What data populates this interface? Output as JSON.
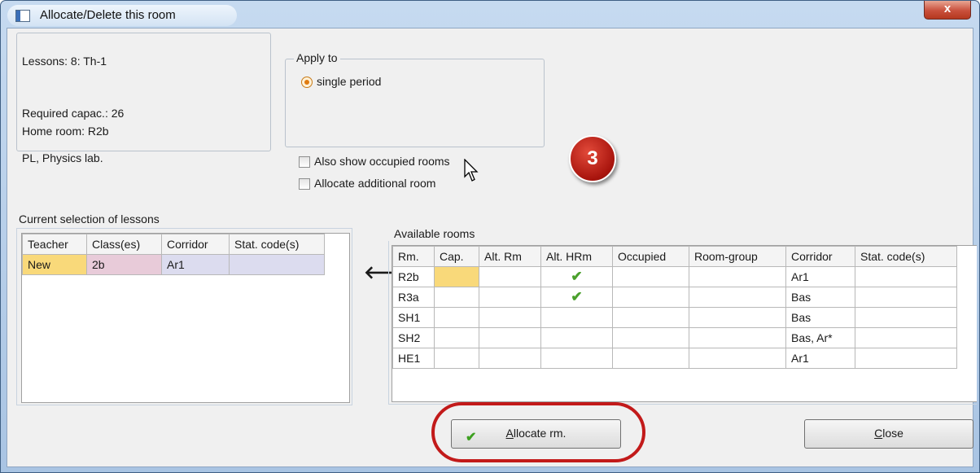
{
  "window": {
    "title": "Allocate/Delete this room",
    "close_glyph": "x"
  },
  "info": {
    "lessons": "Lessons: 8: Th-1",
    "required_capacity": "Required capac.: 26",
    "home_room": "Home room: R2b",
    "room_desc": "PL, Physics lab."
  },
  "apply_to": {
    "legend": "Apply to",
    "option": "single period"
  },
  "checkboxes": {
    "also_show_occupied": "Also show occupied rooms",
    "allocate_additional": "Allocate additional room"
  },
  "badge": "3",
  "current_selection": {
    "label": "Current selection of lessons",
    "columns": [
      "Teacher",
      "Class(es)",
      "Corridor",
      "Stat. code(s)"
    ],
    "rows": [
      [
        "New",
        "2b",
        "Ar1",
        ""
      ]
    ]
  },
  "arrow_glyph": "🡐",
  "available_rooms": {
    "label": "Available rooms",
    "columns": [
      "Rm.",
      "Cap.",
      "Alt. Rm",
      "Alt. HRm",
      "Occupied",
      "Room-group",
      "Corridor",
      "Stat. code(s)"
    ],
    "rows": [
      {
        "rm": "R2b",
        "corridor": "Ar1",
        "alt_hrm": true
      },
      {
        "rm": "R3a",
        "corridor": "Bas",
        "alt_hrm": true
      },
      {
        "rm": "SH1",
        "corridor": "Bas",
        "alt_hrm": false
      },
      {
        "rm": "SH2",
        "corridor": "Bas, Ar*",
        "alt_hrm": false
      },
      {
        "rm": "HE1",
        "corridor": "Ar1",
        "alt_hrm": false
      }
    ],
    "check_glyph": "✔"
  },
  "buttons": {
    "allocate": "Allocate rm.",
    "close": "Close"
  },
  "colors": {
    "highlight_oval": "#c21a1a",
    "check_green": "#4aa02c",
    "teacher_cell": "#f9d97a"
  },
  "icons": [
    "app-icon",
    "close-icon",
    "radio-selected-icon",
    "checkbox-icon",
    "mouse-pointer-icon",
    "left-arrow-icon",
    "green-check-icon"
  ]
}
